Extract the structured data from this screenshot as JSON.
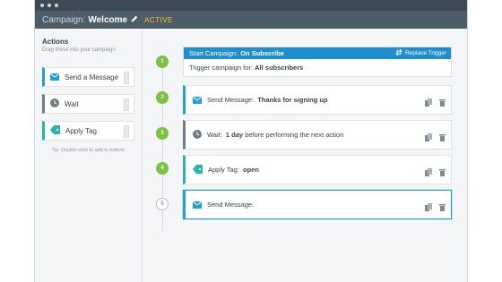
{
  "window": {
    "title_prefix": "Campaign:",
    "campaign_name": "Welcome",
    "status": "ACTIVE"
  },
  "sidebar": {
    "title": "Actions",
    "subtitle": "Drag these into your campaign",
    "actions": [
      {
        "label": "Send a Message",
        "icon": "envelope-icon"
      },
      {
        "label": "Wait",
        "icon": "clock-icon"
      },
      {
        "label": "Apply Tag",
        "icon": "tag-icon"
      }
    ],
    "hint": "Tip: Double-click to add to bottom"
  },
  "steps": [
    {
      "number": "1"
    },
    {
      "number": "2"
    },
    {
      "number": "3"
    },
    {
      "number": "4"
    },
    {
      "number": "5"
    }
  ],
  "trigger": {
    "prefix": "Start Campaign:",
    "event": "On Subscribe",
    "replace_label": "Replace Trigger",
    "body_prefix": "Trigger campaign for:",
    "body_value": "All subscribers"
  },
  "cards": [
    {
      "prefix": "Send Message:",
      "value": "Thanks for signing up",
      "icon": "envelope-icon"
    },
    {
      "prefix": "Wait:",
      "value": "1 day",
      "suffix": "before performing the next action",
      "icon": "clock-icon"
    },
    {
      "prefix": "Apply Tag:",
      "value": "open",
      "icon": "tag-icon"
    },
    {
      "prefix": "Send Message:",
      "value": "",
      "icon": "envelope-icon"
    }
  ],
  "colors": {
    "accent_blue": "#1e8ecf",
    "step_green": "#7cc242",
    "title_bar": "#4d5d68",
    "status_yellow": "#f3c12a"
  }
}
